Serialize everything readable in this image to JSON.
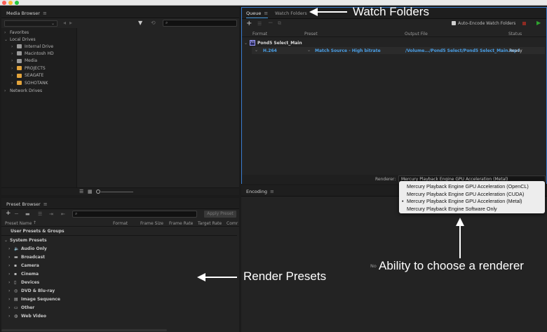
{
  "media_browser": {
    "title": "Media Browser",
    "menu_icon": "≡",
    "favorites": "Favorites",
    "local_drives": "Local Drives",
    "drives": [
      {
        "name": "Internal Drive",
        "color": "#9a9a9a"
      },
      {
        "name": "Macintosh HD",
        "color": "#9a9a9a"
      },
      {
        "name": "Media",
        "color": "#9a9a9a"
      },
      {
        "name": "PROJECTS",
        "color": "#e3a43c"
      },
      {
        "name": "SEAGATE",
        "color": "#e3a43c"
      },
      {
        "name": "SOHOTANK",
        "color": "#e3a43c"
      }
    ],
    "network_drives": "Network Drives"
  },
  "queue": {
    "tabs": [
      {
        "label": "Queue"
      },
      {
        "label": "Watch Folders"
      }
    ],
    "menu_icon": "≡",
    "auto_encode_label": "Auto-Encode Watch Folders",
    "columns": {
      "format": "Format",
      "preset": "Preset",
      "output_file": "Output File",
      "status": "Status"
    },
    "source": {
      "badge": "Ae",
      "name": "Pond5 Select_Main"
    },
    "item": {
      "format": "H.264",
      "preset": "Match Source - High bitrate",
      "output": "/Volume.../Pond5 Select/Pond5 Select_Main.mp4",
      "status": "Ready"
    },
    "renderer_label": "Renderer:",
    "renderer_value": "Mercury Playback Engine GPU Acceleration (Metal)"
  },
  "renderer_menu": {
    "options": [
      {
        "label": "Mercury Playback Engine GPU Acceleration (OpenCL)",
        "selected": false
      },
      {
        "label": "Mercury Playback Engine GPU Acceleration (CUDA)",
        "selected": false
      },
      {
        "label": "Mercury Playback Engine GPU Acceleration (Metal)",
        "selected": true
      },
      {
        "label": "Mercury Playback Engine Software Only",
        "selected": false
      }
    ],
    "bullet": "•"
  },
  "preset_browser": {
    "title": "Preset Browser",
    "menu_icon": "≡",
    "apply_preset": "Apply Preset",
    "columns": {
      "name": "Preset Name",
      "format": "Format",
      "frame_size": "Frame Size",
      "frame_rate": "Frame Rate",
      "target_rate": "Target Rate",
      "comment": "Comr"
    },
    "user_presets": "User Presets & Groups",
    "system_presets": "System Presets",
    "categories": [
      {
        "label": "Audio Only",
        "icon": "speaker-icon",
        "glyph": "🔈"
      },
      {
        "label": "Broadcast",
        "icon": "broadcast-icon",
        "glyph": "▬"
      },
      {
        "label": "Camera",
        "icon": "camera-icon",
        "glyph": "▪"
      },
      {
        "label": "Cinema",
        "icon": "film-icon",
        "glyph": "▪"
      },
      {
        "label": "Devices",
        "icon": "phone-icon",
        "glyph": "▯"
      },
      {
        "label": "DVD & Blu-ray",
        "icon": "disc-icon",
        "glyph": "◎"
      },
      {
        "label": "Image Sequence",
        "icon": "image-sequence-icon",
        "glyph": "▤"
      },
      {
        "label": "Other",
        "icon": "monitor-icon",
        "glyph": "▭"
      },
      {
        "label": "Web Video",
        "icon": "globe-icon",
        "glyph": "◍"
      }
    ]
  },
  "encoding": {
    "title": "Encoding",
    "menu_icon": "≡",
    "status_partial": "No"
  },
  "annotations": {
    "watch_folders": "Watch Folders",
    "render_presets": "Render Presets",
    "renderer_choice": "Ability to choose a renderer"
  }
}
